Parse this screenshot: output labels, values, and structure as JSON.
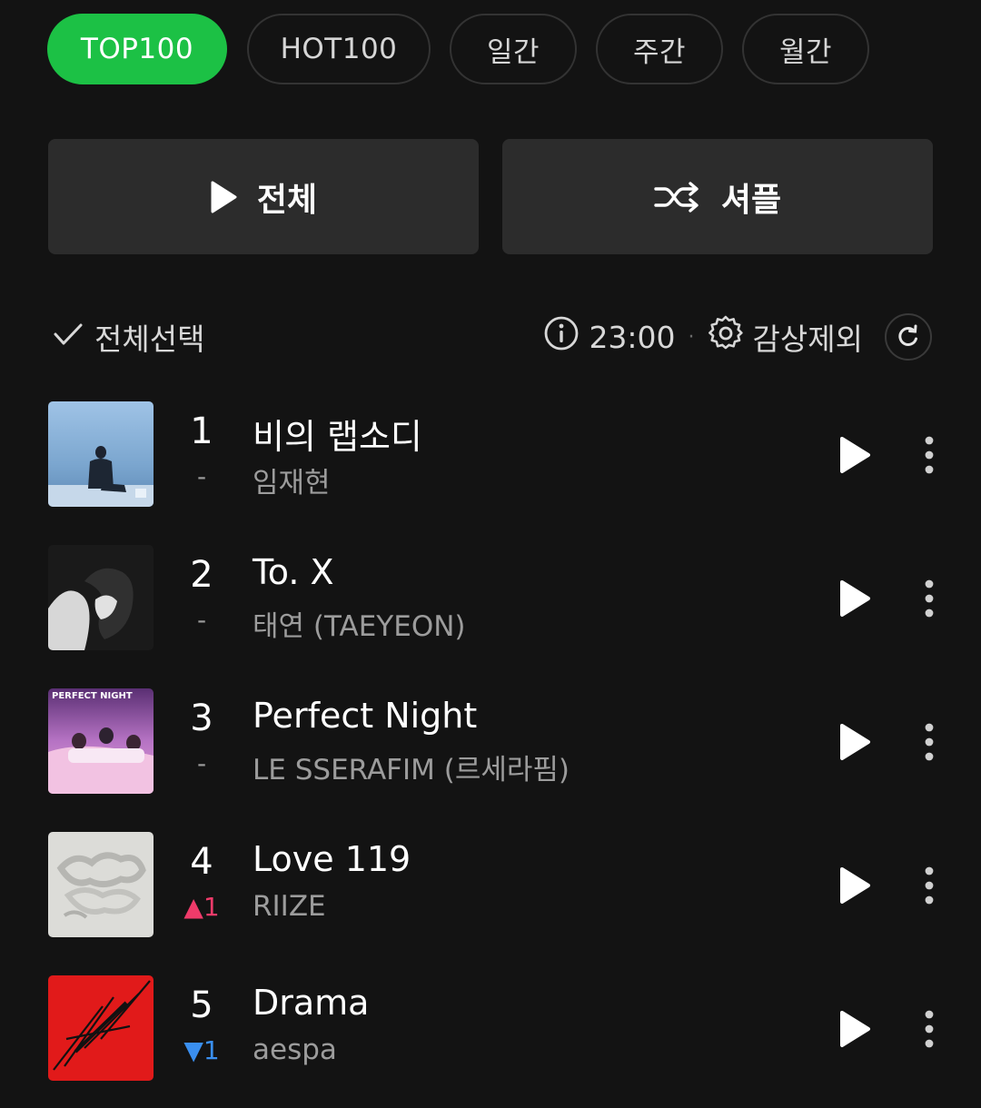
{
  "tabs": [
    {
      "label": "TOP100",
      "active": true
    },
    {
      "label": "HOT100",
      "active": false
    },
    {
      "label": "일간",
      "active": false
    },
    {
      "label": "주간",
      "active": false
    },
    {
      "label": "월간",
      "active": false
    }
  ],
  "actions": {
    "play_all_label": "전체",
    "shuffle_label": "셔플"
  },
  "toolbar": {
    "select_all_label": "전체선택",
    "update_time": "23:00",
    "separator": "·",
    "exclude_label": "감상제외"
  },
  "songs": [
    {
      "rank": "1",
      "change": "-",
      "change_type": "same",
      "title": "비의 랩소디",
      "artist": "임재현"
    },
    {
      "rank": "2",
      "change": "-",
      "change_type": "same",
      "title": "To. X",
      "artist": "태연 (TAEYEON)"
    },
    {
      "rank": "3",
      "change": "-",
      "change_type": "same",
      "title": "Perfect Night",
      "artist": "LE SSERAFIM (르세라핌)",
      "art_text": "PERFECT NIGHT"
    },
    {
      "rank": "4",
      "change": "▲1",
      "change_type": "up",
      "title": "Love 119",
      "artist": "RIIZE"
    },
    {
      "rank": "5",
      "change": "▼1",
      "change_type": "down",
      "title": "Drama",
      "artist": "aespa"
    }
  ],
  "colors": {
    "accent": "#1cc145",
    "up": "#ef3b6a",
    "down": "#3a8ff0",
    "background": "#131313"
  }
}
